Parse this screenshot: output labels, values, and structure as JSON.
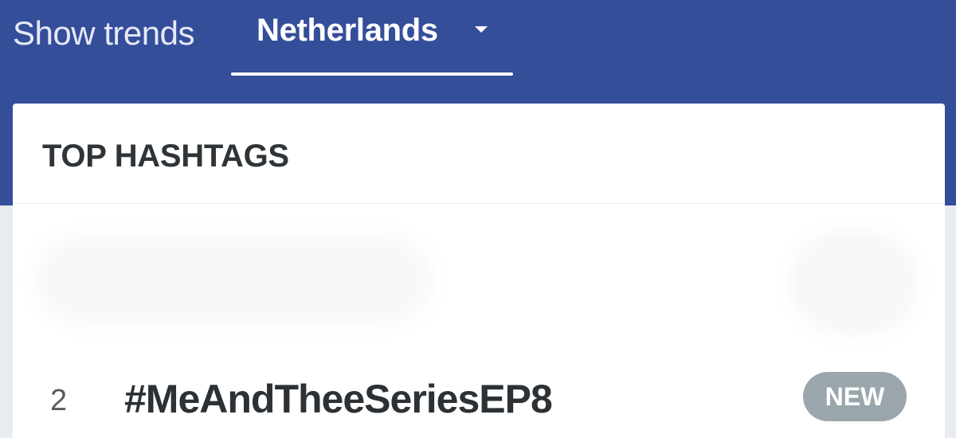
{
  "header": {
    "show_trends_label": "Show trends",
    "country_selected": "Netherlands",
    "accent_color": "#344e9a"
  },
  "card": {
    "title": "TOP HASHTAGS",
    "rows": [
      {
        "rank": "2",
        "hashtag": "#MeAndTheeSeriesEP8",
        "badge": "NEW"
      }
    ]
  },
  "icons": {
    "country_dropdown": "caret-down-icon"
  }
}
